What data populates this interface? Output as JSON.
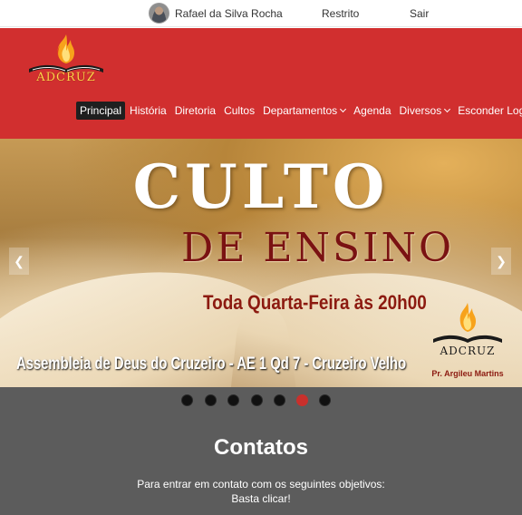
{
  "userbar": {
    "username": "Rafael da Silva Rocha",
    "restrito": "Restrito",
    "sair": "Sair"
  },
  "header": {
    "logo_text": "ADCRUZ",
    "nav": [
      {
        "label": "Principal",
        "active": true
      },
      {
        "label": "História"
      },
      {
        "label": "Diretoria"
      },
      {
        "label": "Cultos"
      },
      {
        "label": "Departamentos",
        "dropdown": true
      },
      {
        "label": "Agenda"
      },
      {
        "label": "Diversos",
        "dropdown": true
      },
      {
        "label": "Esconder Login"
      }
    ]
  },
  "carousel": {
    "line1": "CULTO",
    "line2": "DE ENSINO",
    "line3": "Toda Quarta-Feira às 20h00",
    "line4": "Assembleia de Deus do Cruzeiro - AE 1 Qd 7 - Cruzeiro Velho",
    "logo_name": "ADCRUZ",
    "pastor": "Pr. Argileu Martins",
    "prev_icon": "chevron-left-icon",
    "next_icon": "chevron-right-icon",
    "slide_count": 7,
    "active_slide": 6
  },
  "contatos": {
    "title": "Contatos",
    "line1": "Para entrar em contato com os seguintes objetivos:",
    "line2": "Basta clicar!"
  },
  "colors": {
    "header_red": "#d12f2f",
    "active_nav_bg": "#1f1f1f",
    "lower_gray": "#5c5c5c",
    "active_dot": "#c9302c",
    "slide_title_red": "#7a1212"
  }
}
